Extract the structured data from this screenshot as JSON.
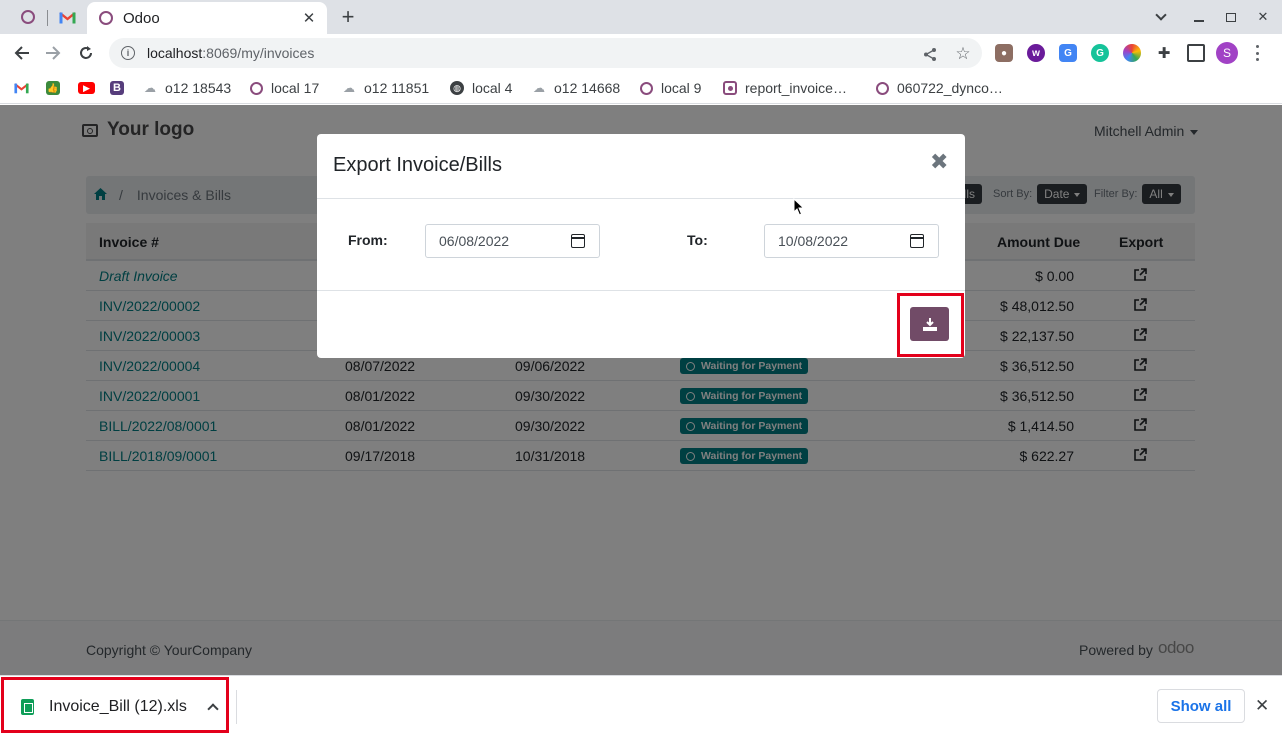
{
  "browser": {
    "active_tab_title": "Odoo",
    "url_host": "localhost",
    "url_rest": ":8069/my/invoices",
    "bookmarks": [
      {
        "label": "",
        "icon": "gmail-icon"
      },
      {
        "label": "",
        "icon": "thumbs-up-icon"
      },
      {
        "label": "",
        "icon": "youtube-icon"
      },
      {
        "label": "",
        "icon": "bootstrap-icon"
      },
      {
        "label": "o12 18543",
        "icon": "cloud-icon"
      },
      {
        "label": "local 17",
        "icon": "odoo-ring-icon"
      },
      {
        "label": "o12 11851",
        "icon": "cloud-icon"
      },
      {
        "label": "local 4",
        "icon": "globe-icon"
      },
      {
        "label": "o12 14668",
        "icon": "cloud-icon"
      },
      {
        "label": "local 9",
        "icon": "odoo-ring-icon"
      },
      {
        "label": "report_invoice…",
        "icon": "odoo-square-icon"
      },
      {
        "label": "060722_dynco…",
        "icon": "odoo-ring-icon"
      }
    ]
  },
  "header": {
    "logo_text": "Your logo",
    "user_name": "Mitchell Admin"
  },
  "breadcrumb": {
    "current": "Invoices & Bills",
    "bills_pill": "Bills",
    "sort_label": "Sort By:",
    "sort_value": "Date",
    "filter_label": "Filter By:",
    "filter_value": "All"
  },
  "table": {
    "headers": {
      "invoice": "Invoice #",
      "amount_due": "Amount Due",
      "export": "Export"
    },
    "rows": [
      {
        "number": "Draft Invoice",
        "date": "",
        "due": "",
        "status": "",
        "amount": "$ 0.00"
      },
      {
        "number": "INV/2022/00002",
        "date": "",
        "due": "",
        "status": "",
        "amount": "$ 48,012.50"
      },
      {
        "number": "INV/2022/00003",
        "date": "",
        "due": "",
        "status": "",
        "amount": "$ 22,137.50"
      },
      {
        "number": "INV/2022/00004",
        "date": "08/07/2022",
        "due": "09/06/2022",
        "status": "Waiting for Payment",
        "amount": "$ 36,512.50"
      },
      {
        "number": "INV/2022/00001",
        "date": "08/01/2022",
        "due": "09/30/2022",
        "status": "Waiting for Payment",
        "amount": "$ 36,512.50"
      },
      {
        "number": "BILL/2022/08/0001",
        "date": "08/01/2022",
        "due": "09/30/2022",
        "status": "Waiting for Payment",
        "amount": "$ 1,414.50"
      },
      {
        "number": "BILL/2018/09/0001",
        "date": "09/17/2018",
        "due": "10/31/2018",
        "status": "Waiting for Payment",
        "amount": "$ 622.27"
      }
    ]
  },
  "modal": {
    "title": "Export Invoice/Bills",
    "close_glyph": "✖",
    "from_label": "From:",
    "from_value": "06/08/2022",
    "to_label": "To:",
    "to_value": "10/08/2022"
  },
  "footer": {
    "copyright": "Copyright © YourCompany",
    "powered_by": "Powered by",
    "brand": "odoo"
  },
  "downloads": {
    "file_name": "Invoice_Bill (12).xls",
    "show_all": "Show all"
  },
  "colors": {
    "odoo_teal": "#017e84",
    "odoo_purple": "#714b67",
    "highlight_red": "#e3001b"
  }
}
